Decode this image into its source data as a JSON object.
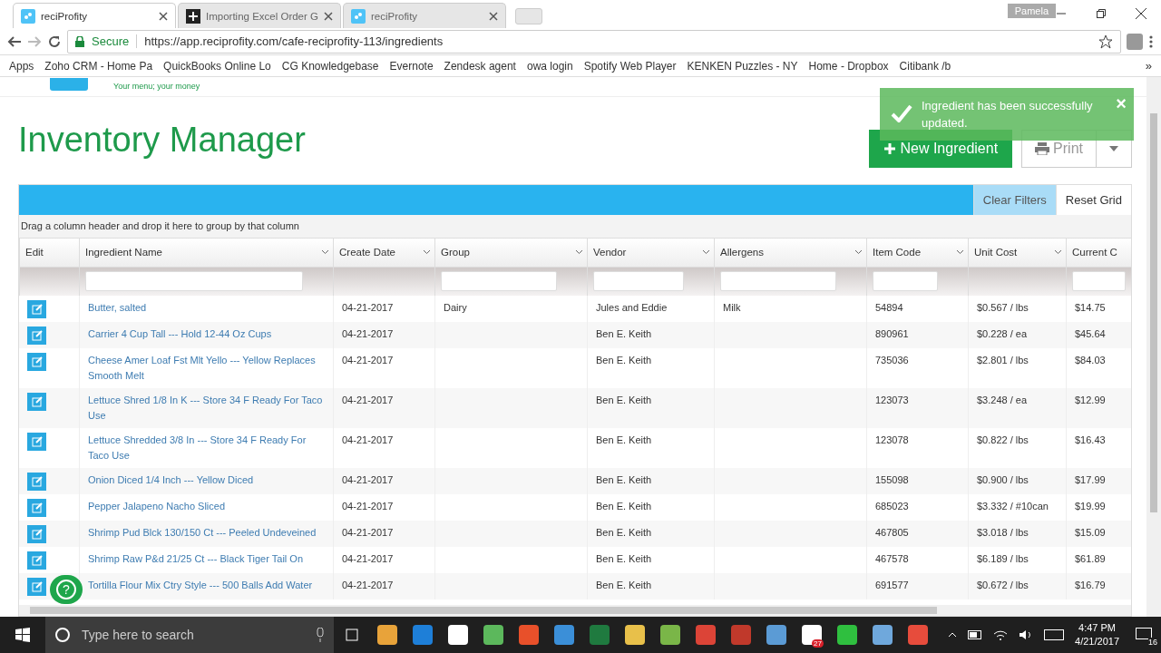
{
  "browser": {
    "tabs": [
      {
        "title": "reciProfity",
        "selected": true,
        "kind": "app"
      },
      {
        "title": "Importing Excel Order G",
        "selected": false,
        "kind": "plus"
      },
      {
        "title": "reciProfity",
        "selected": false,
        "kind": "app"
      }
    ],
    "profile": "Pamela",
    "address": {
      "secure": "Secure",
      "url": "https://app.reciprofity.com/cafe-reciprofity-113/ingredients"
    },
    "bookmarks": [
      {
        "label": "Apps"
      },
      {
        "label": "Zoho CRM - Home Pa"
      },
      {
        "label": "QuickBooks Online Lo"
      },
      {
        "label": "CG Knowledgebase"
      },
      {
        "label": "Evernote"
      },
      {
        "label": "Zendesk agent"
      },
      {
        "label": "owa login"
      },
      {
        "label": "Spotify Web Player"
      },
      {
        "label": "KENKEN Puzzles - NY"
      },
      {
        "label": "Home - Dropbox"
      },
      {
        "label": "Citibank /b"
      }
    ],
    "more": "»"
  },
  "page": {
    "slogan": "Your menu; your money",
    "title": "Inventory Manager",
    "toast": {
      "message": "Ingredient has been successfully updated.",
      "close": "×"
    },
    "new_button": "New Ingredient",
    "print_button": "Print",
    "grid": {
      "actions": [
        {
          "label": "Clear Filters",
          "highlighted": true
        },
        {
          "label": "Reset Grid",
          "highlighted": false
        }
      ],
      "group_hint": "Drag a column header and drop it here to group by that column",
      "columns": [
        {
          "label": "Edit",
          "filter": false,
          "menu": false
        },
        {
          "label": "Ingredient Name",
          "filter": true,
          "menu": true
        },
        {
          "label": "Create Date",
          "filter": false,
          "menu": true
        },
        {
          "label": "Group",
          "filter": true,
          "menu": true
        },
        {
          "label": "Vendor",
          "filter": true,
          "menu": true
        },
        {
          "label": "Allergens",
          "filter": true,
          "menu": true
        },
        {
          "label": "Item Code",
          "filter": true,
          "menu": true
        },
        {
          "label": "Unit Cost",
          "filter": false,
          "menu": true
        },
        {
          "label": "Current C",
          "filter": true,
          "menu": false
        }
      ],
      "rows": [
        {
          "name": "Butter, salted",
          "date": "04-21-2017",
          "group": "Dairy",
          "vendor": "Jules and Eddie",
          "allergens": "Milk",
          "code": "54894",
          "unit_cost": "$0.567 / lbs",
          "current": "$14.75"
        },
        {
          "name": "Carrier 4 Cup Tall --- Hold 12-44 Oz Cups",
          "date": "04-21-2017",
          "vendor": "Ben E. Keith",
          "code": "890961",
          "unit_cost": "$0.228 / ea",
          "current": "$45.64"
        },
        {
          "name": "Cheese Amer Loaf Fst Mlt Yello --- Yellow Replaces Smooth Melt",
          "date": "04-21-2017",
          "vendor": "Ben E. Keith",
          "code": "735036",
          "unit_cost": "$2.801 / lbs",
          "current": "$84.03"
        },
        {
          "name": "Lettuce Shred 1/8 In K --- Store 34 F Ready For Taco Use",
          "date": "04-21-2017",
          "vendor": "Ben E. Keith",
          "code": "123073",
          "unit_cost": "$3.248 / ea",
          "current": "$12.99"
        },
        {
          "name": "Lettuce Shredded 3/8 In --- Store 34 F Ready For Taco Use",
          "date": "04-21-2017",
          "vendor": "Ben E. Keith",
          "code": "123078",
          "unit_cost": "$0.822 / lbs",
          "current": "$16.43"
        },
        {
          "name": "Onion Diced 1/4 Inch --- Yellow Diced",
          "date": "04-21-2017",
          "vendor": "Ben E. Keith",
          "code": "155098",
          "unit_cost": "$0.900 / lbs",
          "current": "$17.99"
        },
        {
          "name": "Pepper Jalapeno Nacho Sliced",
          "date": "04-21-2017",
          "vendor": "Ben E. Keith",
          "code": "685023",
          "unit_cost": "$3.332 / #10can",
          "current": "$19.99"
        },
        {
          "name": "Shrimp Pud Blck 130/150 Ct --- Peeled Undeveined",
          "date": "04-21-2017",
          "vendor": "Ben E. Keith",
          "code": "467805",
          "unit_cost": "$3.018 / lbs",
          "current": "$15.09"
        },
        {
          "name": "Shrimp Raw P&d 21/25 Ct --- Black Tiger Tail On",
          "date": "04-21-2017",
          "vendor": "Ben E. Keith",
          "code": "467578",
          "unit_cost": "$6.189 / lbs",
          "current": "$61.89"
        },
        {
          "name": "Tortilla Flour Mix Ctry Style --- 500 Balls Add Water",
          "date": "04-21-2017",
          "vendor": "Ben E. Keith",
          "code": "691577",
          "unit_cost": "$0.672 / lbs",
          "current": "$16.79"
        }
      ]
    },
    "help": "?"
  },
  "taskbar": {
    "search_placeholder": "Type here to search",
    "apps": [
      {
        "color": "#e8a33a"
      },
      {
        "color": "#1e7fd8"
      },
      {
        "color": "#ffffff"
      },
      {
        "color": "#5cb85c"
      },
      {
        "color": "#e8502a"
      },
      {
        "color": "#3b8fd8"
      },
      {
        "color": "#1f7a3f"
      },
      {
        "color": "#e8c04a"
      },
      {
        "color": "#7ab648"
      },
      {
        "color": "#dc4437"
      },
      {
        "color": "#c0392b"
      },
      {
        "color": "#5b9bd5"
      },
      {
        "color": "#ffffff",
        "badge": "27"
      },
      {
        "color": "#2fbf3f"
      },
      {
        "color": "#6fa8dc"
      },
      {
        "color": "#e74c3c"
      }
    ],
    "time": "4:47 PM",
    "date": "4/21/2017",
    "notifications": "16"
  }
}
